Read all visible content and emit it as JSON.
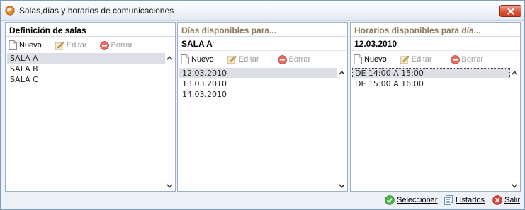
{
  "window": {
    "title": "Salas,días y horarios de comunicaciones"
  },
  "panels": {
    "rooms": {
      "header": "Definición de salas",
      "toolbar": {
        "new_label": "Nuevo",
        "edit_label": "Editar",
        "delete_label": "Borrar"
      },
      "items": [
        "SALA A",
        "SALA B",
        "SALA C"
      ],
      "selected_index": 0
    },
    "days": {
      "header": "Días disponibles para...",
      "context": "SALA A",
      "toolbar": {
        "new_label": "Nuevo",
        "edit_label": "Editar",
        "delete_label": "Borrar"
      },
      "items": [
        "12.03.2010",
        "13.03.2010",
        "14.03.2010"
      ],
      "selected_index": 0
    },
    "hours": {
      "header": "Horarios disponibles para día...",
      "context": "12.03.2010",
      "toolbar": {
        "new_label": "Nuevo",
        "edit_label": "Editar",
        "delete_label": "Borrar"
      },
      "items": [
        "DE 14:00 A 15:00",
        "DE 15:00 A 16:00"
      ],
      "selected_index": 0
    }
  },
  "footer": {
    "select_label": "Seleccionar",
    "list_label": "Listados",
    "exit_label": "Salir"
  },
  "icons": {
    "app": "app-globe-icon",
    "close": "close-icon",
    "new": "new-document-icon",
    "edit": "edit-pencil-icon",
    "delete": "delete-minus-icon",
    "select": "check-circle-icon",
    "list": "listing-pages-icon",
    "exit": "exit-x-icon",
    "scroll_up": "chevron-up-icon",
    "scroll_down": "chevron-down-icon"
  },
  "colors": {
    "close_button": "#d8553a",
    "delete_icon": "#d9534f",
    "select_icon": "#3aa53a",
    "exit_icon": "#d32f2f",
    "selection": "#dcdfe4",
    "header_muted": "#8c7a5a"
  }
}
